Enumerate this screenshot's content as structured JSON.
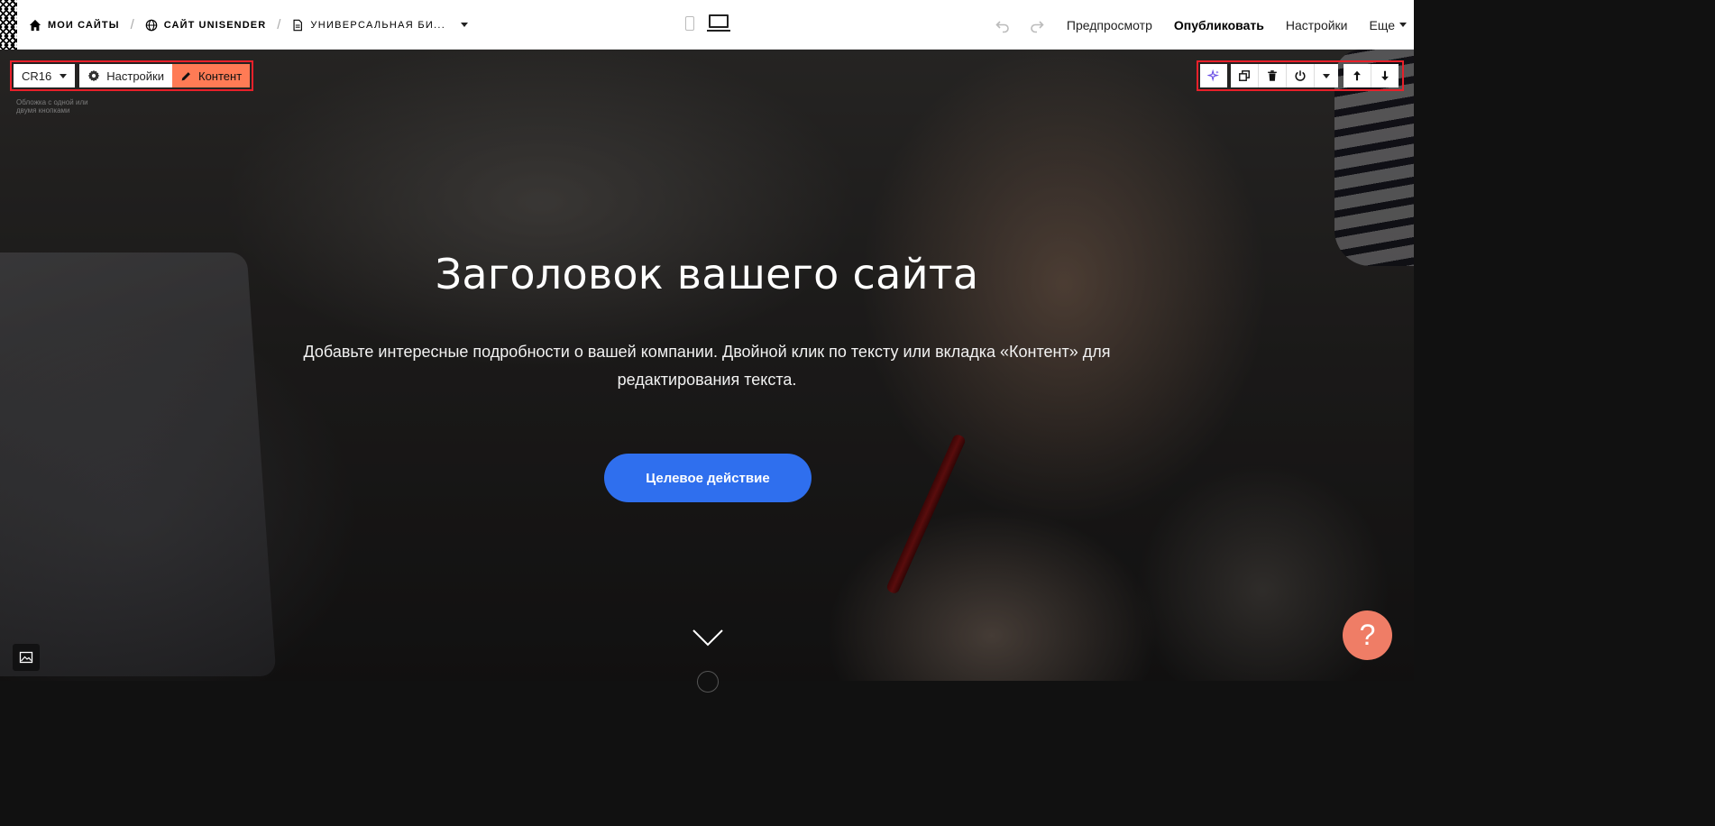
{
  "breadcrumbs": {
    "my_sites": "Мои сайты",
    "site": "Сайт Unisender",
    "page": "Универсальная би..."
  },
  "nav": {
    "preview": "Предпросмотр",
    "publish": "Опубликовать",
    "settings": "Настройки",
    "more": "Еще"
  },
  "block_toolbar": {
    "block_code": "CR16",
    "settings_label": "Настройки",
    "content_label": "Контент",
    "caption": "Обложка с одной или двумя кнопками"
  },
  "hero": {
    "title": "Заголовок вашего сайта",
    "subtitle": "Добавьте интересные подробности о вашей компании. Двойной клик по тексту или вкладка «Контент» для редактирования текста.",
    "button": "Целевое действие"
  },
  "help": {
    "label": "?"
  },
  "colors": {
    "accent_button": "#2f6fee",
    "content_tab": "#ff7b55",
    "highlight_border": "#e8202a",
    "help_button": "#ef7d66"
  },
  "icons": [
    "home-icon",
    "globe-icon",
    "page-icon",
    "phone-icon",
    "laptop-icon",
    "undo-icon",
    "redo-icon",
    "gear-icon",
    "pencil-icon",
    "sparkle-icon",
    "duplicate-icon",
    "trash-icon",
    "power-icon",
    "arrow-up-icon",
    "arrow-down-icon",
    "image-icon",
    "chevron-down-icon"
  ]
}
